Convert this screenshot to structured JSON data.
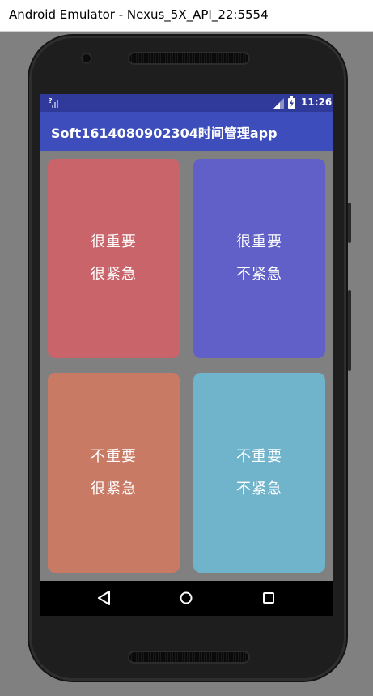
{
  "window": {
    "title": "Android Emulator - Nexus_5X_API_22:5554"
  },
  "status_bar": {
    "time": "11:26",
    "icons": [
      "sim-no-signal-icon",
      "cell-signal-icon",
      "battery-charging-icon"
    ]
  },
  "app_bar": {
    "title": "Soft1614080902304时间管理app"
  },
  "quadrants": [
    {
      "line1": "很重要",
      "line2": "很紧急",
      "color": "#c8646a"
    },
    {
      "line1": "很重要",
      "line2": "不紧急",
      "color": "#6060c8"
    },
    {
      "line1": "不重要",
      "line2": "很紧急",
      "color": "#c97a64"
    },
    {
      "line1": "不重要",
      "line2": "不紧急",
      "color": "#70b4cc"
    }
  ],
  "nav_bar": {
    "icons": [
      "back-icon",
      "home-icon",
      "recents-icon"
    ]
  },
  "colors": {
    "status_bar": "#2f3a9a",
    "app_bar": "#3d4dbb",
    "background": "#808080",
    "nav_bar": "#000000"
  }
}
